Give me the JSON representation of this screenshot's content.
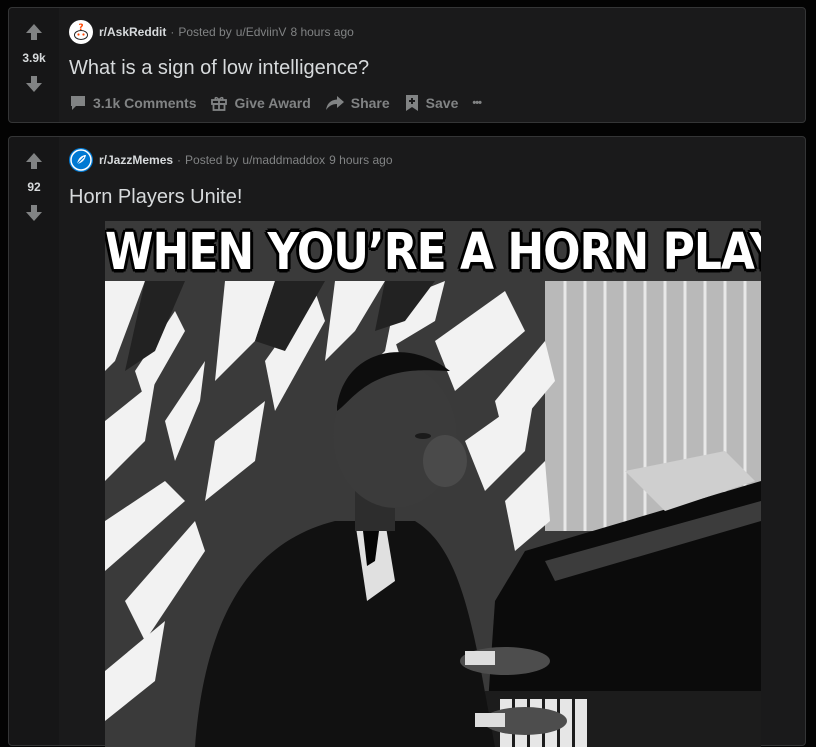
{
  "posts": [
    {
      "score": "3.9k",
      "subreddit": "r/AskReddit",
      "posted_by_prefix": "Posted by",
      "author": "u/EdviinV",
      "time_ago": "8 hours ago",
      "title": "What is a sign of low intelligence?",
      "actions": {
        "comments": "3.1k Comments",
        "award": "Give Award",
        "share": "Share",
        "save": "Save",
        "more": "•••"
      }
    },
    {
      "score": "92",
      "subreddit": "r/JazzMemes",
      "posted_by_prefix": "Posted by",
      "author": "u/maddmaddox",
      "time_ago": "9 hours ago",
      "title": "Horn Players Unite!",
      "image": {
        "caption": "WHEN YOU’RE A HORN PLAYER"
      }
    }
  ],
  "colors": {
    "page_bg": "#030303",
    "card_bg": "#1a1a1b",
    "card_border": "#343536",
    "text_primary": "#d7dadc",
    "text_muted": "#818384",
    "askreddit_icon_bg": "#ffffff",
    "jazzmemes_icon_bg": "#0079d3"
  },
  "icons": {
    "upvote": "upvote-arrow-icon",
    "downvote": "downvote-arrow-icon",
    "comments": "comment-bubble-icon",
    "award": "gift-icon",
    "share": "share-arrow-icon",
    "save": "bookmark-plus-icon",
    "more": "more-dots-icon"
  }
}
